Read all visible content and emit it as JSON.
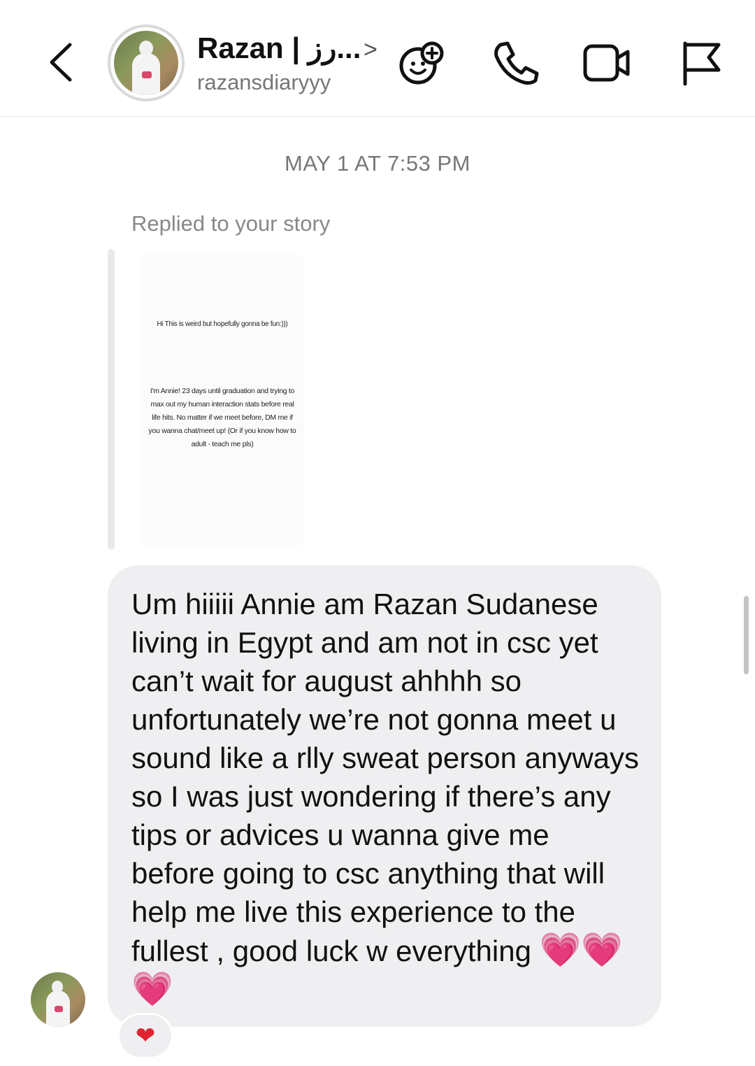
{
  "header": {
    "back_icon": "chevron-left-icon",
    "contact_name": "Razan | رز...",
    "contact_username": "razansdiaryyy",
    "chevron": ">",
    "icons": [
      "add-effects-icon",
      "phone-icon",
      "video-call-icon",
      "flag-icon"
    ]
  },
  "conversation": {
    "timestamp": "MAY 1 AT 7:53 PM",
    "reply_label": "Replied to your story",
    "story": {
      "line1": "Hi This is weird but hopefully gonna be fun:)))",
      "line2": "I'm Annie! 23 days until graduation and trying to max out my human interaction stats before real life hits. No matter if we meet before, DM me if you wanna chat/meet up! (Or if you know how to adult - teach me pls)"
    },
    "message": {
      "text": "Um hiiiii Annie am Razan Sudanese living in Egypt and am not in csc yet can’t wait for august ahhhh so unfortunately we’re not gonna meet u sound like a rlly sweat person anyways so I was just wondering if there’s any tips or advices u wanna give me before going to csc anything that will help me live this experience to the fullest , good luck w everything",
      "emoji": "💗💗💗"
    },
    "reaction": "❤"
  },
  "colors": {
    "bubble": "#efeff1",
    "heart_pink": "#ff3fb3",
    "reaction_red": "#e0242f",
    "muted_text": "#777777"
  }
}
